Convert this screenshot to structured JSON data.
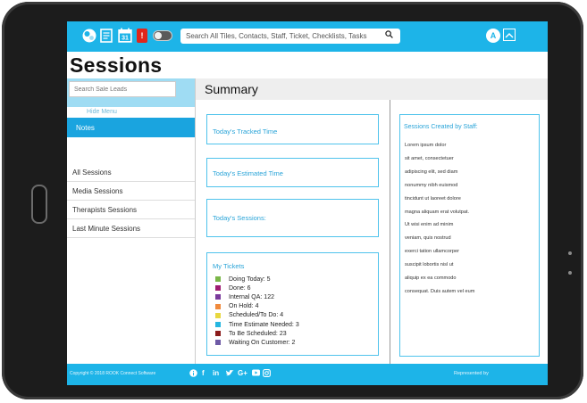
{
  "page": {
    "title": "Sessions"
  },
  "topbar": {
    "search_placeholder": "Search All Tiles, Contacts, Staff, Ticket, Checklists, Tasks",
    "calendar_day": "31",
    "alert_mark": "!",
    "avatar_initial": "A"
  },
  "sidebar": {
    "search_placeholder": "Search Sale Leads",
    "hide_menu": "Hide Menu",
    "active_item": "Notes",
    "items": [
      "All Sessions",
      "Media Sessions",
      "Therapists Sessions",
      "Last Minute Sessions"
    ]
  },
  "main": {
    "header": "Summary",
    "cards": {
      "tracked": "Today's Tracked Time",
      "estimated": "Today's Estimated Time",
      "sessions": "Today's Sessions:"
    },
    "tickets": {
      "title": "My Tickets",
      "rows": [
        {
          "label": "Doing Today: 5",
          "color": "#7ab648"
        },
        {
          "label": "Done: 6",
          "color": "#9e1c72"
        },
        {
          "label": "Internal QA: 122",
          "color": "#7a3b9c"
        },
        {
          "label": "On Hold: 4",
          "color": "#f08a3c"
        },
        {
          "label": "Scheduled/To Do: 4",
          "color": "#e8d840"
        },
        {
          "label": "Time Estimate Needed: 3",
          "color": "#25b6e0"
        },
        {
          "label": "To Be Scheduled: 23",
          "color": "#8b1b1b"
        },
        {
          "label": "Waiting On Customer: 2",
          "color": "#6e5aa6"
        }
      ]
    },
    "staff": {
      "title": "Sessions Created by Staff:",
      "lines": [
        "Lorem ipsum dolor",
        "sit amet, consectetuer",
        "adipiscing elit, sed diam",
        "nonummy nibh euismod",
        "tincidunt ut laoreet dolore",
        "magna aliquam erat volutpat.",
        "Ut wisi enim ad minim",
        "veniam, quis nostrud",
        "exerci tation ullamcorper",
        "suscipit lobortis nisl ut",
        "aliquip ex ea commodo",
        "consequat. Duis autem vel eum"
      ]
    }
  },
  "footer": {
    "copyright": "Copyright © 2018 ROOK Connect Software",
    "represented": "Represented by",
    "social_icons": [
      "info-icon",
      "facebook-icon",
      "linkedin-icon",
      "twitter-icon",
      "google-plus-icon",
      "youtube-icon",
      "instagram-icon"
    ]
  },
  "colors": {
    "accent": "#1db4e8",
    "active_nav": "#1aa4df",
    "card_border": "#4fc3ec"
  }
}
